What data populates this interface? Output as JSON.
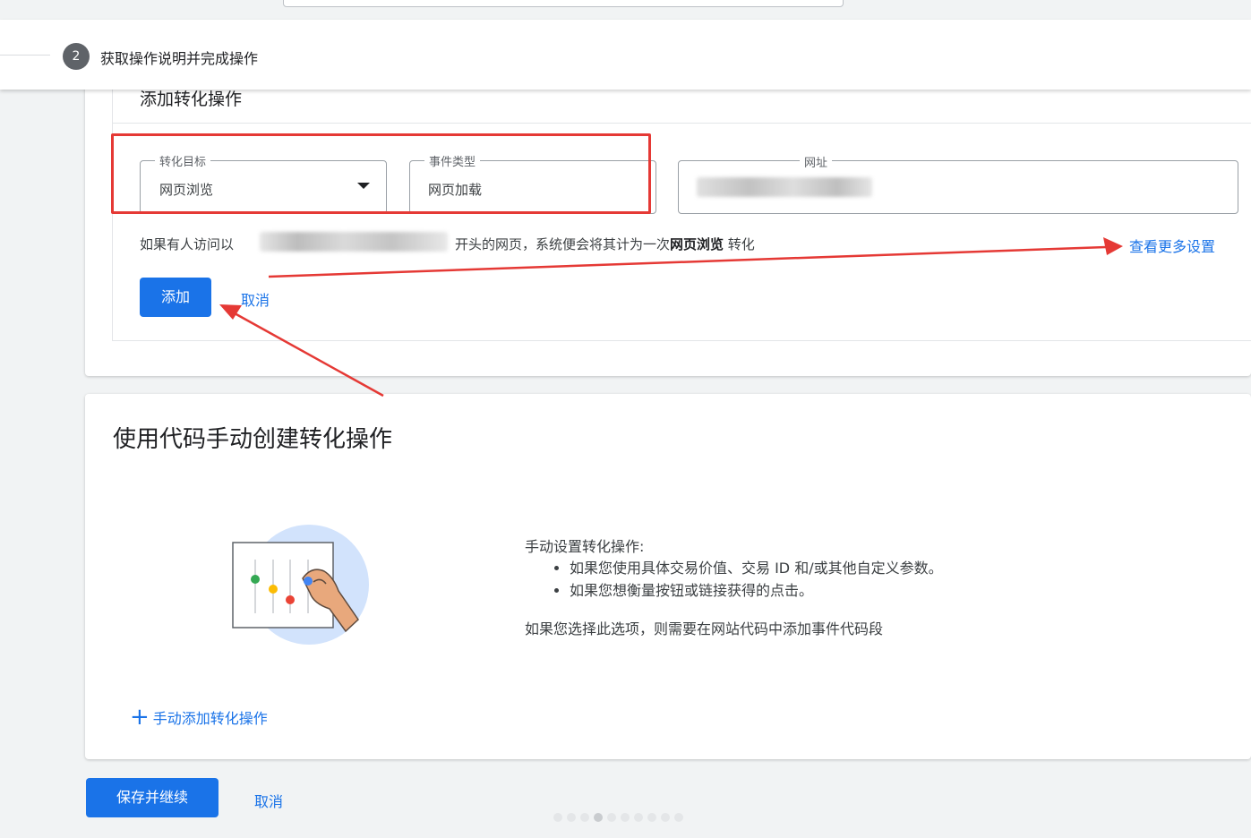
{
  "stepper": {
    "step_number": "2",
    "step_label": "获取操作说明并完成操作"
  },
  "add_conversion": {
    "title": "添加转化操作",
    "goal_field": {
      "label": "转化目标",
      "value": "网页浏览"
    },
    "event_field": {
      "label": "事件类型",
      "value": "网页加载"
    },
    "url_field": {
      "label": "网址"
    },
    "description_before": "如果有人访问以",
    "description_after": "开头的网页，系统便会将其计为一次",
    "description_bold": "网页浏览",
    "description_end": " 转化",
    "more_settings_link": "查看更多设置",
    "add_button": "添加",
    "cancel_link": "取消"
  },
  "manual_card": {
    "title": "使用代码手动创建转化操作",
    "intro": "手动设置转化操作:",
    "bullets": [
      "如果您使用具体交易价值、交易 ID 和/或其他自定义参数。",
      "如果您想衡量按钮或链接获得的点击。"
    ],
    "note": "如果您选择此选项，则需要在网站代码中添加事件代码段",
    "add_link": "手动添加转化操作"
  },
  "footer": {
    "save_button": "保存并继续",
    "cancel_link": "取消"
  },
  "colors": {
    "primary": "#1a73e8",
    "annotation_red": "#e53935"
  },
  "icons": {
    "dropdown": "triangle-down-icon",
    "add": "plus-icon",
    "illustration": "slider-hand-illustration"
  }
}
